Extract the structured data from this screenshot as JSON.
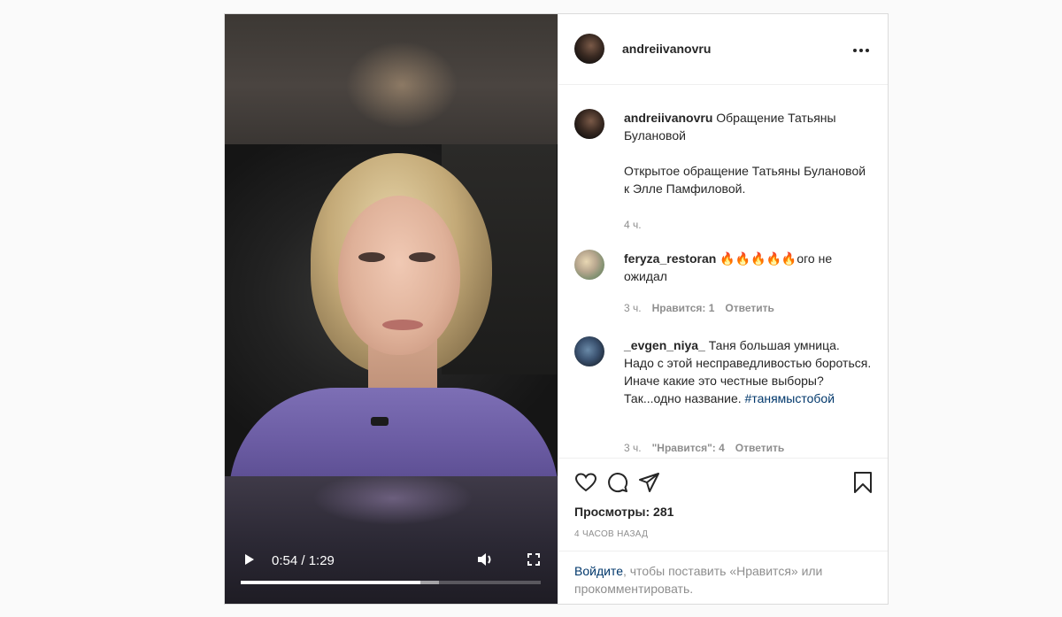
{
  "video": {
    "time": "0:54 / 1:29",
    "progress_fraction": 0.6,
    "buffered_fraction": 0.66
  },
  "header": {
    "username": "andreiivanovru"
  },
  "caption": {
    "username": "andreiivanovru",
    "title": "Обращение Татьяны Булановой",
    "body": "Открытое обращение Татьяны Булановой к Элле Памфиловой.",
    "time": "4 ч."
  },
  "comments": [
    {
      "username": "feryza_restoran",
      "text": "🔥🔥🔥🔥🔥ого не ожидал",
      "time": "3 ч.",
      "likes": "Нравится: 1",
      "reply": "Ответить"
    },
    {
      "username": "_evgen_niya_",
      "text": "Таня большая умница. Надо с этой несправедливостью бороться. Иначе какие это честные выборы? Так...одно название.",
      "hashtag": "#танямыстобой",
      "time": "3 ч.",
      "likes": "\"Нравится\": 4",
      "reply": "Ответить"
    }
  ],
  "stats": {
    "views": "Просмотры: 281",
    "posted": "4 ЧАСОВ НАЗАД"
  },
  "login_prompt": {
    "link": "Войдите",
    "rest": ", чтобы поставить «Нравится» или прокомментировать."
  },
  "icons": [
    "play-icon",
    "volume-icon",
    "fullscreen-icon",
    "more-icon",
    "heart-icon",
    "comment-icon",
    "share-icon",
    "bookmark-icon"
  ]
}
